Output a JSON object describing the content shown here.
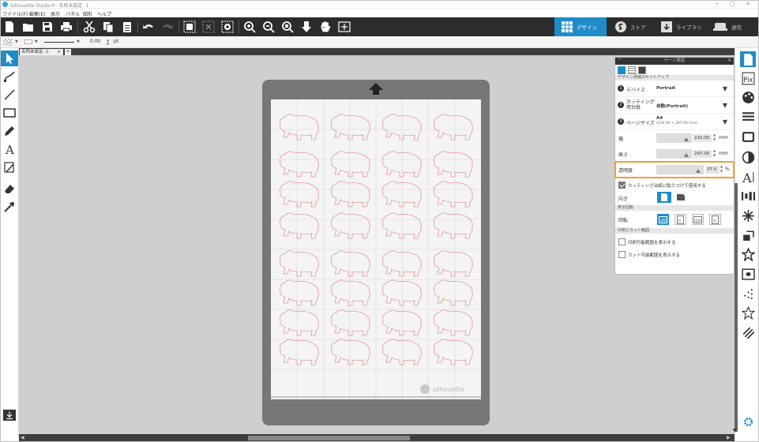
{
  "titlebar": {
    "title": "Silhouette Studio®: 名称未設定 -1",
    "minimize": "─",
    "maximize": "□",
    "close": "✕"
  },
  "menu": [
    "ファイル(F)",
    "編集(E)",
    "表示",
    "パネル",
    "図形",
    "ヘルプ"
  ],
  "mode_tabs": [
    {
      "label": "デザイン",
      "icon": "design-grid-icon",
      "active": true
    },
    {
      "label": "ストア",
      "icon": "store-icon",
      "active": false
    },
    {
      "label": "ライブラリ",
      "icon": "library-icon",
      "active": false
    },
    {
      "label": "送信",
      "icon": "send-icon",
      "active": false
    }
  ],
  "options_bar": {
    "line_width": "0.00",
    "line_unit": "pt"
  },
  "document_tab": {
    "title": "名称未設定 -1",
    "close": "×",
    "add": "+"
  },
  "canvas": {
    "watermark": "silhouette"
  },
  "page_panel": {
    "title": "ページ設定",
    "section_design": "デザイン領域のセットアップ",
    "device_label": "デバイス",
    "device_value": "Portrait",
    "mat_label": "カッティング用台紙",
    "mat_value": "自動(Portrait)",
    "page_size_label": "ページサイズ",
    "page_size_value": "A4",
    "page_size_sub": "(210.00 × 297.00 mm)",
    "width_label": "幅",
    "width_value": "210.00",
    "width_unit": "mm",
    "height_label": "高さ",
    "height_value": "297.00",
    "height_unit": "mm",
    "transparency_label": "透明度",
    "transparency_value": "37.0",
    "transparency_unit": "%",
    "stick_label": "カッティング台紙に貼りつけて使用する",
    "stick_checked": true,
    "orientation_label": "向き",
    "section_view": "表示回転",
    "rotate_label": "回転",
    "section_print": "印刷とカット範囲",
    "show_print_label": "印刷可能範囲を表示する",
    "show_cut_label": "カット可能範囲を表示する"
  },
  "colors": {
    "accent": "#1f8cc7",
    "toolbar": "#2c2c2c",
    "canvas": "#cfcfcf",
    "mat": "#777777",
    "cut_line": "#e8949a",
    "highlight": "#f0a030"
  }
}
